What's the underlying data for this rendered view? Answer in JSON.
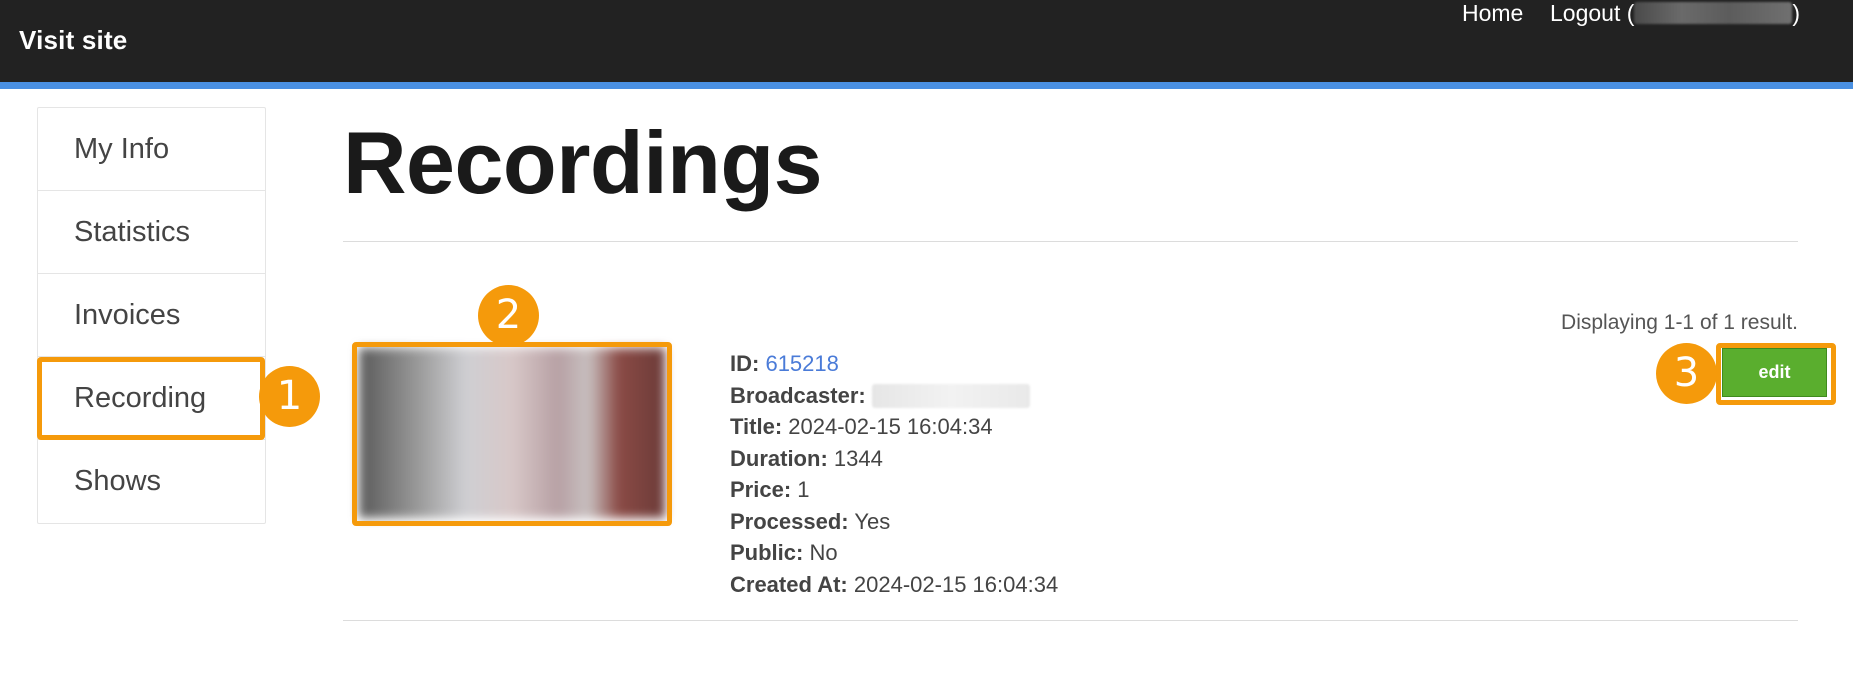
{
  "navbar": {
    "brand": "Visit site",
    "home_label": "Home",
    "logout_prefix": "Logout (",
    "logout_suffix": ")"
  },
  "sidebar": {
    "items": [
      {
        "label": "My Info"
      },
      {
        "label": "Statistics"
      },
      {
        "label": "Invoices"
      },
      {
        "label": "Recording"
      },
      {
        "label": "Shows"
      }
    ]
  },
  "main": {
    "title": "Recordings",
    "summary": "Displaying 1-1 of 1 result.",
    "edit_label": "edit",
    "recording": {
      "id_label": "ID:",
      "id_value": "615218",
      "broadcaster_label": "Broadcaster:",
      "title_label": "Title:",
      "title_value": "2024-02-15 16:04:34",
      "duration_label": "Duration:",
      "duration_value": "1344",
      "price_label": "Price:",
      "price_value": "1",
      "processed_label": "Processed:",
      "processed_value": "Yes",
      "public_label": "Public:",
      "public_value": "No",
      "created_label": "Created At:",
      "created_value": "2024-02-15 16:04:34"
    }
  },
  "annotations": {
    "badge_1": "1",
    "badge_2": "2",
    "badge_3": "3"
  },
  "colors": {
    "navbar_bg": "#222222",
    "navbar_accent": "#4a90e2",
    "highlight": "#f59a0b",
    "edit_button": "#5aae2e",
    "link": "#4a7bd8"
  }
}
